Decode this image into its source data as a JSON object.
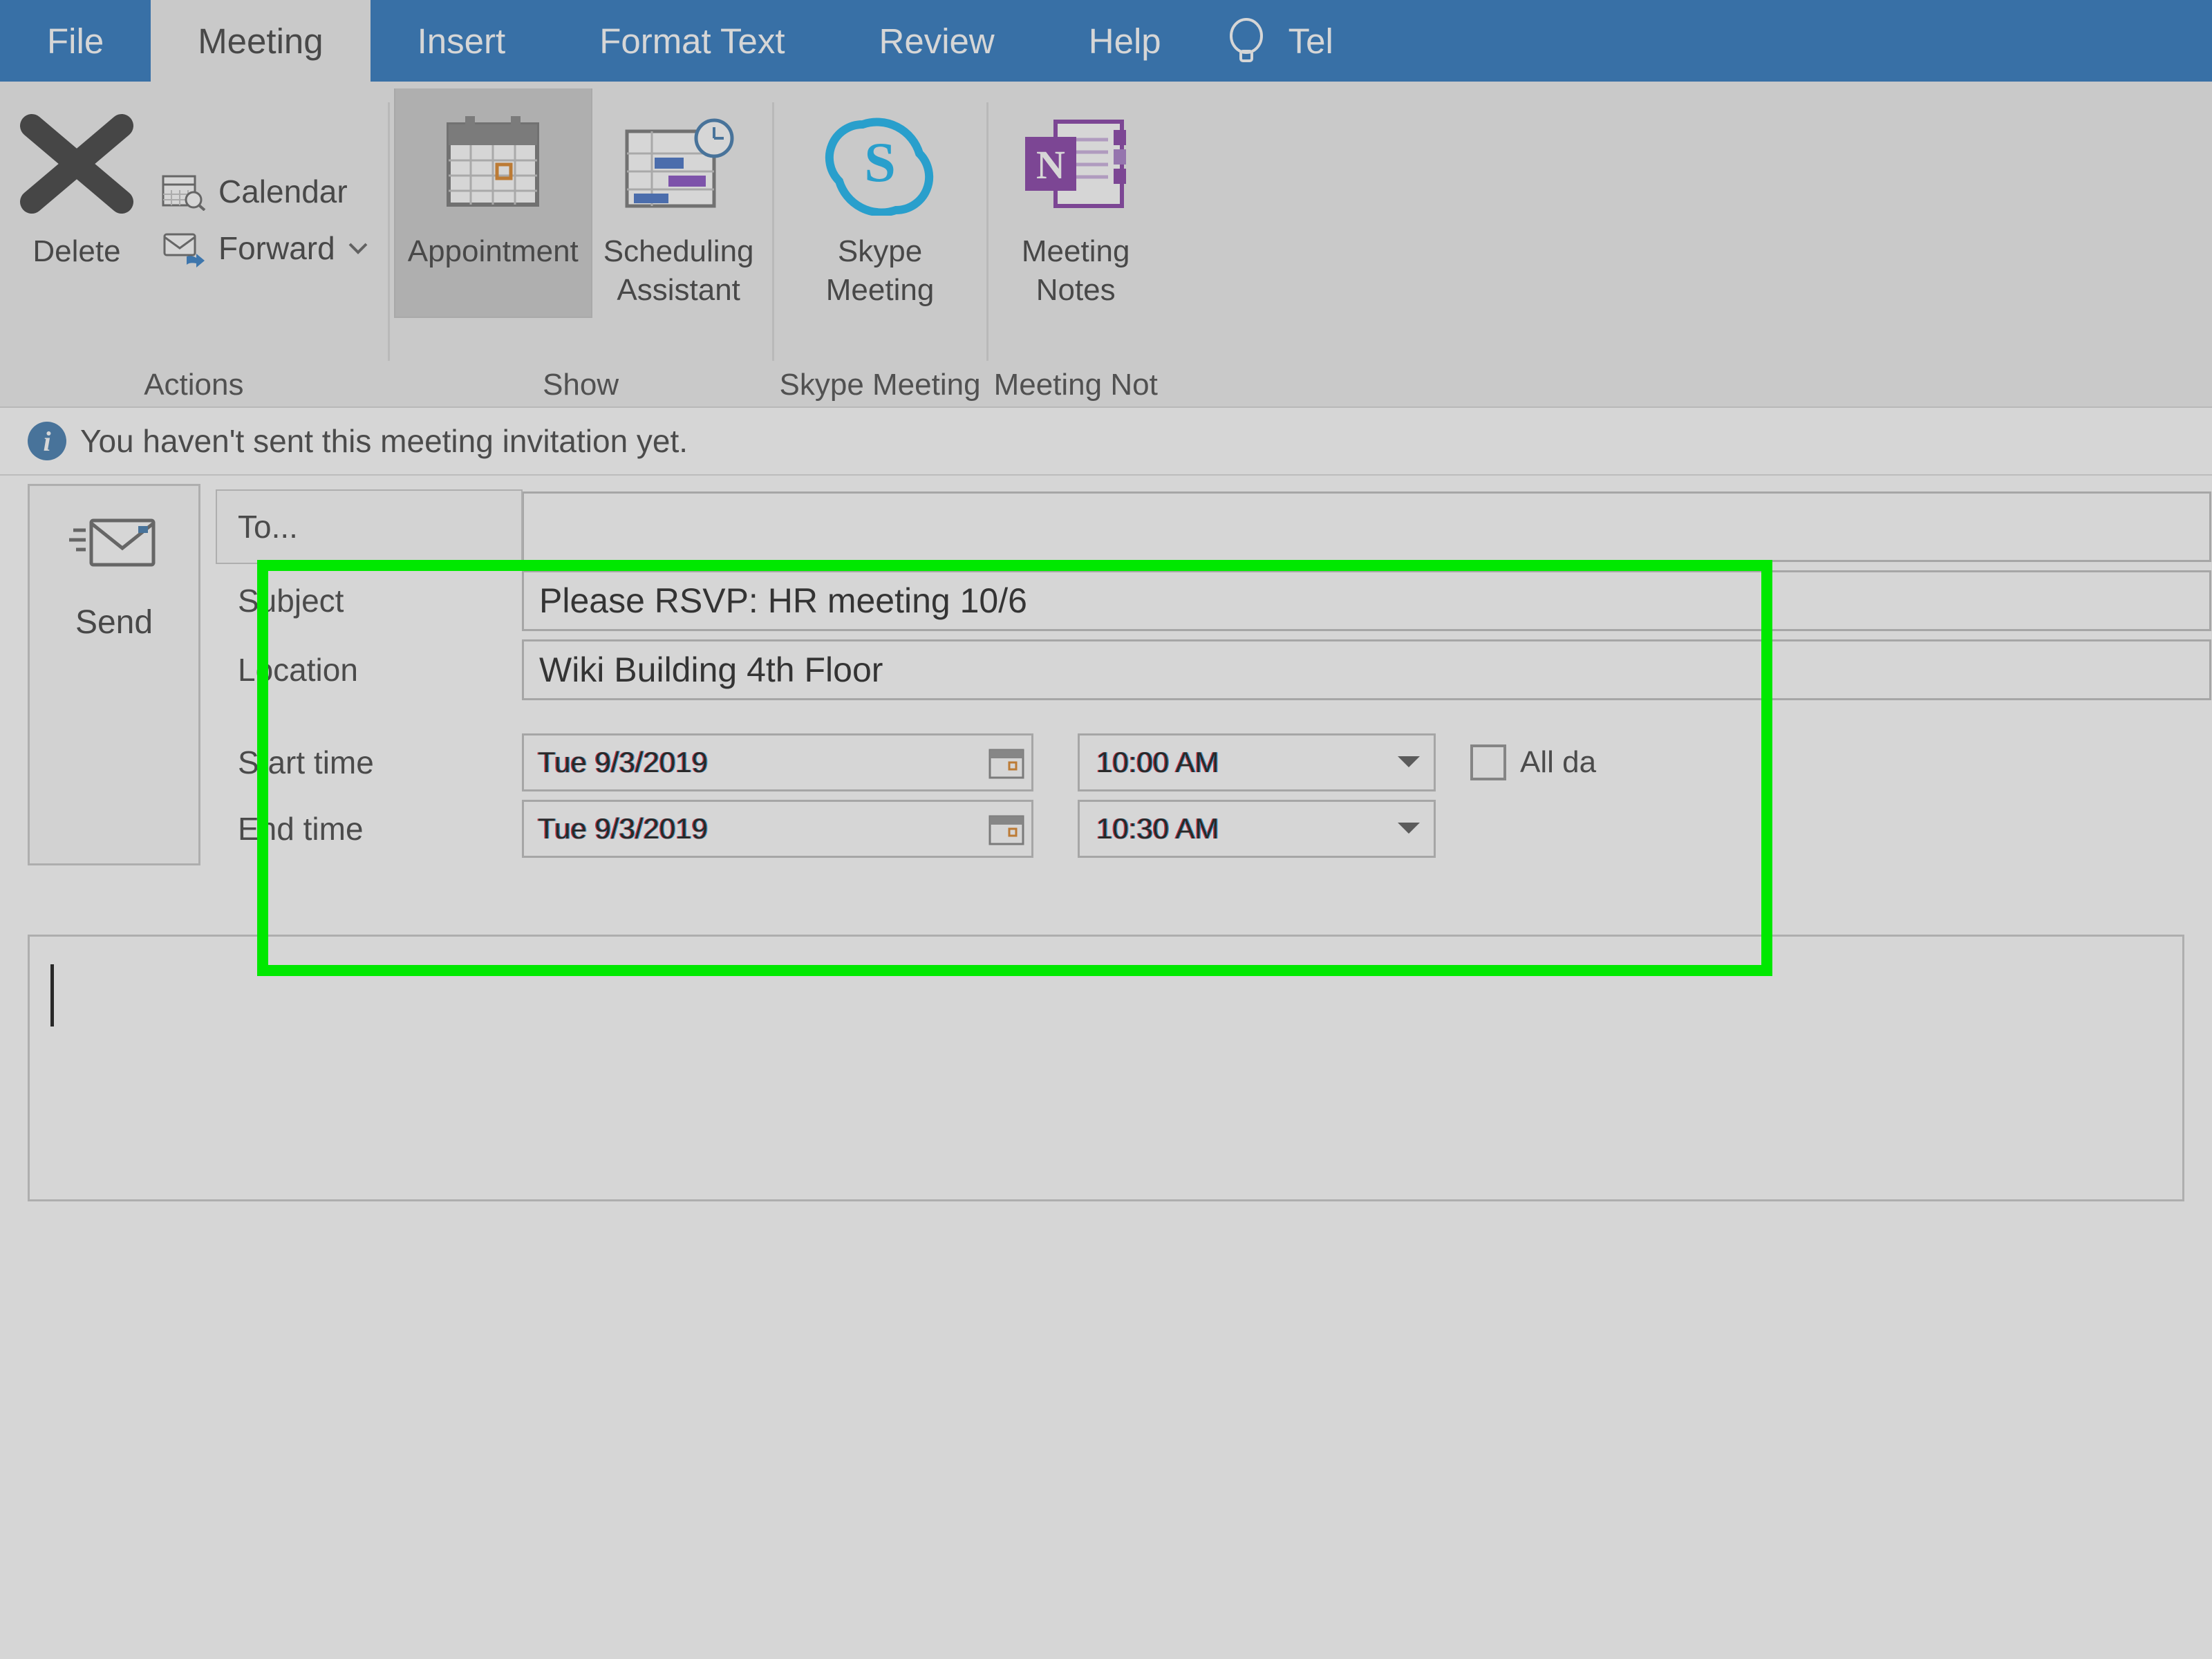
{
  "tabs": {
    "file": "File",
    "meeting": "Meeting",
    "insert": "Insert",
    "format_text": "Format Text",
    "review": "Review",
    "help": "Help",
    "tell_me": "Tel"
  },
  "ribbon": {
    "actions": {
      "label": "Actions",
      "delete": "Delete",
      "calendar": "Calendar",
      "forward": "Forward"
    },
    "show": {
      "label": "Show",
      "appointment": "Appointment",
      "scheduling_assistant_l1": "Scheduling",
      "scheduling_assistant_l2": "Assistant"
    },
    "skype": {
      "label": "Skype Meeting",
      "skype_l1": "Skype",
      "skype_l2": "Meeting"
    },
    "notes": {
      "label": "Meeting Not",
      "notes_l1": "Meeting",
      "notes_l2": "Notes"
    }
  },
  "infobar": "You haven't sent this meeting invitation yet.",
  "send": {
    "label": "Send"
  },
  "fields": {
    "to_label": "To...",
    "subject_label": "Subject",
    "subject_value": "Please RSVP: HR meeting 10/6",
    "location_label": "Location",
    "location_value": "Wiki Building 4th Floor",
    "start_label": "Start time",
    "start_date": "Tue 9/3/2019",
    "start_time": "10:00 AM",
    "end_label": "End time",
    "end_date": "Tue 9/3/2019",
    "end_time": "10:30 AM",
    "all_day": "All da"
  }
}
